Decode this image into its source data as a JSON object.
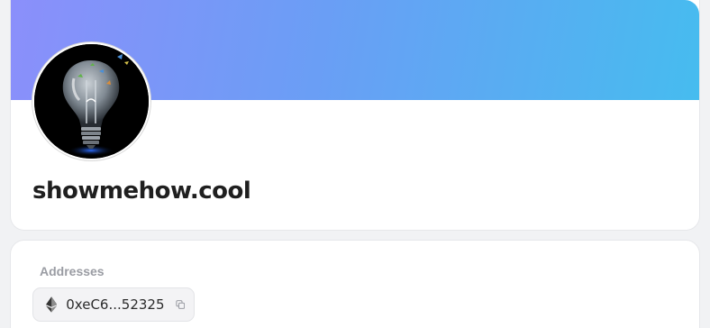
{
  "profile": {
    "name": "showmehow.cool",
    "banner_gradient": [
      "#8b8ffb",
      "#46bcef"
    ],
    "avatar_icon": "lightbulb-avatar"
  },
  "addresses": {
    "label": "Addresses",
    "items": [
      {
        "chain_icon": "ethereum-icon",
        "address": "0xeC6...52325",
        "action_icon": "copy-icon"
      }
    ]
  }
}
